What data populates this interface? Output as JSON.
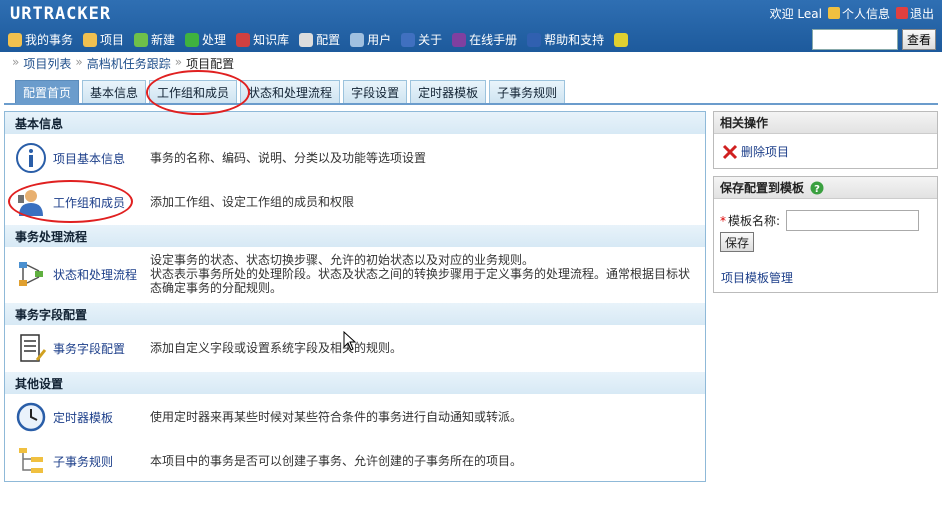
{
  "header": {
    "logo": "URTRACKER",
    "welcome": "欢迎 Leal",
    "profile": "个人信息",
    "logout": "退出",
    "search_button": "查看"
  },
  "nav": [
    {
      "label": "我的事务",
      "icon": "home-icon",
      "color": "#f2c14e"
    },
    {
      "label": "项目",
      "icon": "database-icon",
      "color": "#f0c050"
    },
    {
      "label": "新建",
      "icon": "new-icon",
      "color": "#6fc04a"
    },
    {
      "label": "处理",
      "icon": "check-icon",
      "color": "#3fb23f"
    },
    {
      "label": "知识库",
      "icon": "books-icon",
      "color": "#d04040"
    },
    {
      "label": "配置",
      "icon": "gear-icon",
      "color": "#dddddd"
    },
    {
      "label": "用户",
      "icon": "users-icon",
      "color": "#a0c0e0"
    },
    {
      "label": "关于",
      "icon": "info-icon",
      "color": "#4070c0"
    },
    {
      "label": "在线手册",
      "icon": "manual-icon",
      "color": "#8040a0"
    },
    {
      "label": "帮助和支持",
      "icon": "help-icon",
      "color": "#3060b0"
    },
    {
      "label": "",
      "icon": "sparkle-icon",
      "color": "#e0d030"
    }
  ],
  "breadcrumb": [
    "项目列表",
    "高档机任务跟踪",
    "项目配置"
  ],
  "tabs": [
    "配置首页",
    "基本信息",
    "工作组和成员",
    "状态和处理流程",
    "字段设置",
    "定时器模板",
    "子事务规则"
  ],
  "sections": {
    "basic": {
      "title": "基本信息",
      "items": [
        {
          "label": "项目基本信息",
          "desc": "事务的名称、编码、说明、分类以及功能等选项设置"
        },
        {
          "label": "工作组和成员",
          "desc": "添加工作组、设定工作组的成员和权限"
        }
      ]
    },
    "flow": {
      "title": "事务处理流程",
      "items": [
        {
          "label": "状态和处理流程",
          "desc_lines": [
            "设定事务的状态、状态切换步骤、允许的初始状态以及对应的业务规则。",
            "状态表示事务所处的处理阶段。状态及状态之间的转换步骤用于定义事务的处理流程。通常根据目标状",
            "态确定事务的分配规则。"
          ]
        }
      ]
    },
    "fields": {
      "title": "事务字段配置",
      "items": [
        {
          "label": "事务字段配置",
          "desc": "添加自定义字段或设置系统字段及相关的规则。"
        }
      ]
    },
    "other": {
      "title": "其他设置",
      "items": [
        {
          "label": "定时器模板",
          "desc": "使用定时器来再某些时候对某些符合条件的事务进行自动通知或转派。"
        },
        {
          "label": "子事务规则",
          "desc": "本项目中的事务是否可以创建子事务、允许创建的子事务所在的项目。"
        }
      ]
    }
  },
  "side": {
    "ops_title": "相关操作",
    "delete_label": "删除项目",
    "save_title": "保存配置到模板",
    "name_label": "模板名称:",
    "name_value": "",
    "save_button": "保存",
    "manage_link": "项目模板管理"
  },
  "colors": {
    "header": "#2466a8",
    "active_tab": "#6b9ccc",
    "annotation": "#e02020"
  }
}
